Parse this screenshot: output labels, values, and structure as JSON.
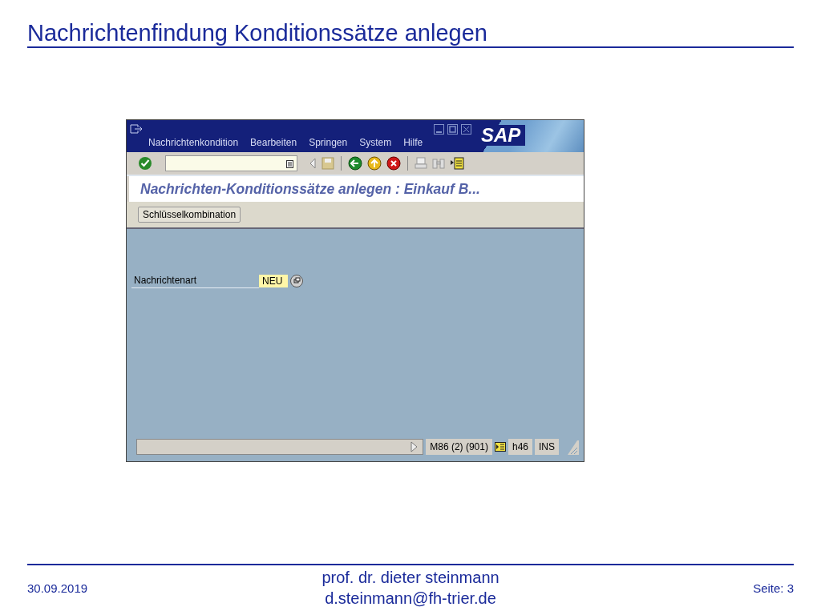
{
  "slide": {
    "title": "Nachrichtenfindung Konditionssätze anlegen"
  },
  "window": {
    "menu": [
      {
        "label": "Nachrichtenkondition"
      },
      {
        "label": "Bearbeiten"
      },
      {
        "label": "Springen"
      },
      {
        "label": "System"
      },
      {
        "label": "Hilfe"
      }
    ],
    "logo": "SAP",
    "screen_title": "Nachrichten-Konditionssätze anlegen : Einkauf B...",
    "app_buttons": [
      "Schlüsselkombination"
    ],
    "fields": [
      {
        "label": "Nachrichtenart",
        "value": "NEU"
      }
    ],
    "status_bar": [
      "M86 (2) (901)",
      "h46",
      "INS"
    ]
  },
  "footer": {
    "date": "30.09.2019",
    "author": "prof. dr. dieter steinmann",
    "email": "d.steinmann@fh-trier.de",
    "page": "Seite: 3"
  }
}
